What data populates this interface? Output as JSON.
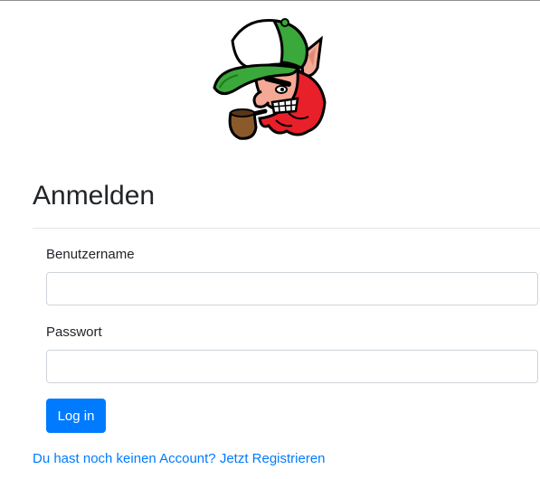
{
  "header": {
    "logo_icon": "leprechaun-mascot-logo-icon"
  },
  "form": {
    "title": "Anmelden",
    "username_label": "Benutzername",
    "username_value": "",
    "password_label": "Passwort",
    "password_value": "",
    "login_label": "Log in"
  },
  "footer": {
    "register_prefix": "Du hast noch keinen Account?",
    "register_link": "Jetzt Registrieren"
  },
  "colors": {
    "primary": "#007bff",
    "text": "#212529",
    "border": "#ced4da",
    "divider": "#e3e5e8",
    "hat_green": "#3aa83a",
    "beard_red": "#e8202a"
  }
}
